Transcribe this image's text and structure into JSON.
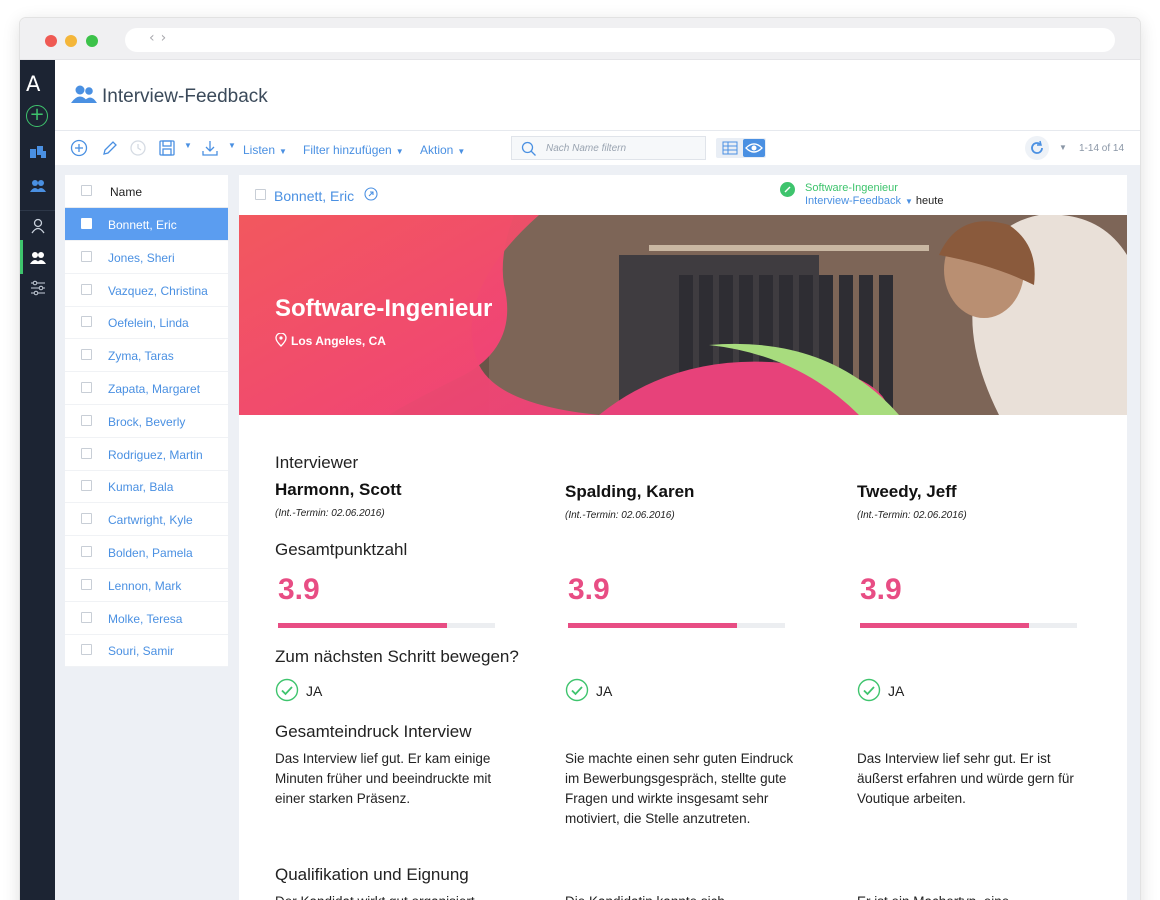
{
  "app": {
    "title": "Interview-Feedback",
    "logo": "A",
    "rail_add": "+"
  },
  "toolbar": {
    "lists_label": "Listen",
    "filter_label": "Filter hinzufügen",
    "action_label": "Aktion",
    "search_placeholder": "Nach Name filtern",
    "pager": "1-14 of 14"
  },
  "list": {
    "header": "Name",
    "items": [
      "Bonnett, Eric",
      "Jones, Sheri",
      "Vazquez, Christina",
      "Oefelein, Linda",
      "Zyma, Taras",
      "Zapata, Margaret",
      "Brock, Beverly",
      "Rodriguez, Martin",
      "Kumar, Bala",
      "Cartwright, Kyle",
      "Bolden, Pamela",
      "Lennon, Mark",
      "Molke, Teresa",
      "Souri, Samir"
    ],
    "selected_index": 0
  },
  "detail": {
    "candidate": "Bonnett, Eric",
    "job": "Software-Ingenieur",
    "feedback_link": "Interview-Feedback",
    "date": "heute",
    "hero_title": "Software-Ingenieur",
    "hero_location": "Los Angeles, CA",
    "interviewer_heading": "Interviewer",
    "score_heading": "Gesamtpunktzahl",
    "next_step_heading": "Zum nächsten Schritt bewegen?",
    "impression_heading": "Gesamteindruck Interview",
    "qualification_heading": "Qualifikation und Eignung",
    "interviewers": [
      {
        "name": "Harmonn, Scott",
        "date": "(Int.-Termin: 02.06.2016)",
        "score": "3.9",
        "score_fraction": 0.78,
        "next_step": "JA",
        "impression": "Das Interview lief gut. Er kam einige Minuten früher und beeindruckte mit einer starken Präsenz.",
        "qualification": "Der Kandidat wirkt gut organisiert"
      },
      {
        "name": "Spalding, Karen",
        "date": "(Int.-Termin: 02.06.2016)",
        "score": "3.9",
        "score_fraction": 0.78,
        "next_step": "JA",
        "impression": "Sie machte einen sehr guten Eindruck im Bewerbungsgespräch, stellte gute Fragen und wirkte insgesamt sehr motiviert, die Stelle anzutreten.",
        "qualification": "Die Kandidatin kannte sich"
      },
      {
        "name": "Tweedy, Jeff",
        "date": "(Int.-Termin: 02.06.2016)",
        "score": "3.9",
        "score_fraction": 0.78,
        "next_step": "JA",
        "impression": "Das Interview lief sehr gut. Er ist äußerst erfahren und würde gern für Voutique arbeiten.",
        "qualification": "Er ist ein Machertyp, eine"
      }
    ]
  },
  "colors": {
    "accent": "#4a90e2",
    "score": "#e84d84",
    "success": "#3ec46d",
    "rail": "#1c2433"
  }
}
